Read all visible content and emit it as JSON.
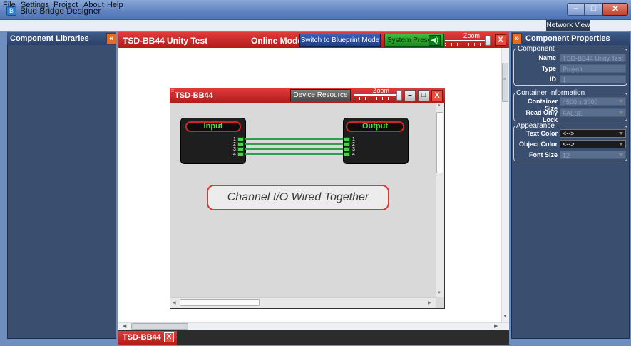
{
  "window": {
    "title": "Blue Bridge Designer",
    "icon": "app-icon"
  },
  "menu": {
    "items": [
      "File",
      "Settings",
      "Project",
      "About",
      "Help"
    ],
    "network_view": "Network View"
  },
  "left_panel": {
    "title": "Component Libraries",
    "collapse_glyph": "«"
  },
  "project": {
    "title": "TSD-BB44 Unity Test",
    "mode": "Online Mode",
    "switch_button": "Switch to Blueprint Mode",
    "presets_button": "System Presets",
    "zoom_label": "Zoom",
    "zoom_level": 1.0
  },
  "device": {
    "title": "TSD-BB44",
    "resource_button": "Device Resource",
    "zoom_label": "Zoom",
    "zoom_level": 1.0,
    "input_block": {
      "label": "Input",
      "pins": [
        "1",
        "2",
        "3",
        "4"
      ]
    },
    "output_block": {
      "label": "Output",
      "pins": [
        "1",
        "2",
        "3",
        "4"
      ]
    },
    "note": "Channel I/O Wired Together"
  },
  "bottom_tab": {
    "label": "TSD-BB44"
  },
  "right_panel": {
    "title": "Component Properties",
    "component_group": "Component",
    "component": [
      {
        "label": "Name",
        "value": "TSD-BB44 Unity Test"
      },
      {
        "label": "Type",
        "value": "Project"
      },
      {
        "label": "ID",
        "value": "1"
      }
    ],
    "container_group": "Container Information",
    "container": [
      {
        "label": "Container Size",
        "value": "4500 x 3000"
      },
      {
        "label": "Read Only Lock",
        "value": "FALSE"
      }
    ],
    "appearance_group": "Appearance",
    "appearance": [
      {
        "label": "Text Color",
        "value": "<-->"
      },
      {
        "label": "Object Color",
        "value": "<-->"
      },
      {
        "label": "Font Size",
        "value": "12"
      }
    ]
  },
  "colors": {
    "accent_red": "#d42222",
    "panel_blue": "#3a4f70",
    "wire_green": "#2f9d4a",
    "orange": "#e86b1f"
  }
}
